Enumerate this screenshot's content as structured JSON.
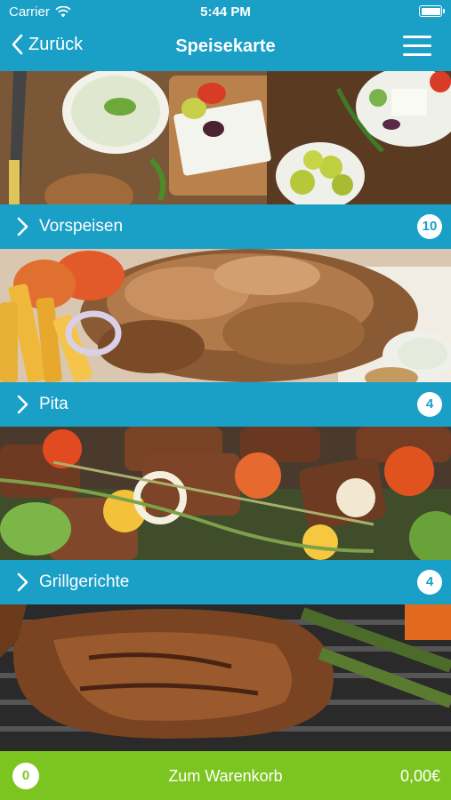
{
  "status_bar": {
    "carrier": "Carrier",
    "time": "5:44 PM"
  },
  "nav": {
    "back_label": "Zurück",
    "title": "Speisekarte"
  },
  "categories": [
    {
      "label": "Vorspeisen",
      "count": "10",
      "icon": "chevron-right-icon",
      "photo": "mezze-platter"
    },
    {
      "label": "Pita",
      "count": "4",
      "icon": "chevron-right-icon",
      "photo": "gyros-with-fries"
    },
    {
      "label": "Grillgerichte",
      "count": "4",
      "icon": "chevron-right-icon",
      "photo": "meat-skewers"
    }
  ],
  "cart": {
    "quantity": "0",
    "label": "Zum Warenkorb",
    "total": "0,00€"
  },
  "colors": {
    "brand_blue": "#1a9fc7",
    "cart_green": "#7cc520"
  }
}
